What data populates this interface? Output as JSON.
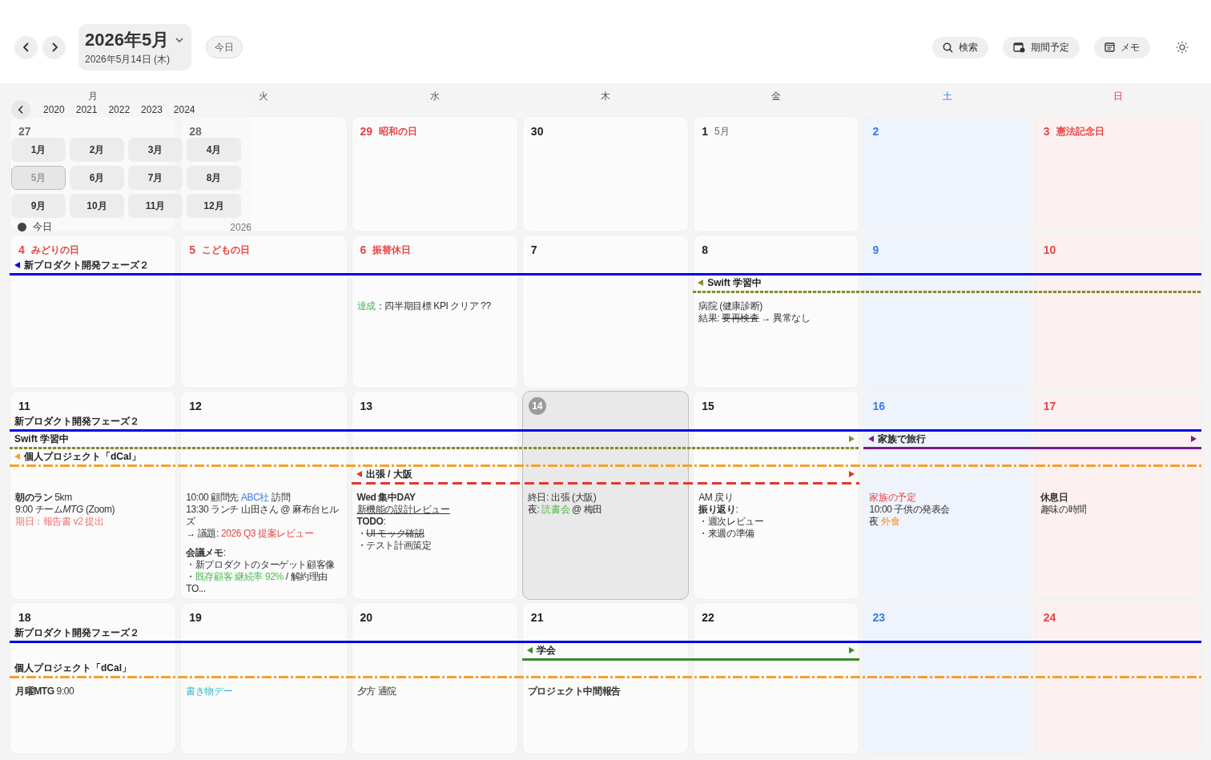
{
  "header": {
    "title": "2026年5月",
    "subtitle": "2026年5月14日 (木)",
    "today_button": "今日",
    "actions": [
      {
        "kind": "search",
        "label": "検索"
      },
      {
        "kind": "period",
        "label": "期間予定"
      },
      {
        "kind": "memo",
        "label": "メモ"
      }
    ]
  },
  "weekdays": [
    {
      "label": "月",
      "kind": "weekday"
    },
    {
      "label": "火",
      "kind": "weekday"
    },
    {
      "label": "水",
      "kind": "weekday"
    },
    {
      "label": "木",
      "kind": "weekday"
    },
    {
      "label": "金",
      "kind": "weekday"
    },
    {
      "label": "土",
      "kind": "sat"
    },
    {
      "label": "日",
      "kind": "sun"
    }
  ],
  "month_picker": {
    "years": [
      "2020",
      "2021",
      "2022",
      "2023",
      "2024"
    ],
    "months": [
      {
        "label": "1月",
        "selected": false
      },
      {
        "label": "2月",
        "selected": false
      },
      {
        "label": "3月",
        "selected": false
      },
      {
        "label": "4月",
        "selected": false
      },
      {
        "label": "5月",
        "selected": true
      },
      {
        "label": "6月",
        "selected": false
      },
      {
        "label": "7月",
        "selected": false
      },
      {
        "label": "8月",
        "selected": false
      },
      {
        "label": "9月",
        "selected": false
      },
      {
        "label": "10月",
        "selected": false
      },
      {
        "label": "11月",
        "selected": false
      },
      {
        "label": "12月",
        "selected": false
      }
    ],
    "today_label": "今日",
    "year_label": "2026"
  },
  "weeks": [
    {
      "days": [
        {
          "date": "27",
          "kind": "weekday",
          "today": false
        },
        {
          "date": "28",
          "kind": "weekday",
          "today": false
        },
        {
          "date": "29",
          "kind": "holiday",
          "holiday": "昭和の日",
          "today": false
        },
        {
          "date": "30",
          "kind": "weekday",
          "today": false
        },
        {
          "date": "1",
          "kind": "weekday",
          "month_label": "5月",
          "today": false
        },
        {
          "date": "2",
          "kind": "sat",
          "today": false
        },
        {
          "date": "3",
          "kind": "sun",
          "holiday": "憲法記念日",
          "today": false
        }
      ]
    },
    {
      "days": [
        {
          "date": "4",
          "kind": "holiday",
          "holiday": "みどりの日",
          "today": false
        },
        {
          "date": "5",
          "kind": "holiday",
          "holiday": "こどもの日",
          "today": false
        },
        {
          "date": "6",
          "kind": "holiday",
          "holiday": "振替休日",
          "today": false,
          "notes": [
            [
              {
                "text": "達成",
                "kind": "green"
              },
              "：四半期目標 KPI クリア ??"
            ]
          ]
        },
        {
          "date": "7",
          "kind": "weekday",
          "today": false
        },
        {
          "date": "8",
          "kind": "weekday",
          "today": false,
          "notes": [
            [
              "病院 (健康診断)"
            ],
            [
              "結果: ",
              {
                "text": "要再検査",
                "kind": "strike"
              },
              " → 異常なし"
            ]
          ]
        },
        {
          "date": "9",
          "kind": "sat",
          "today": false
        },
        {
          "date": "10",
          "kind": "sun",
          "today": false
        }
      ],
      "lanes": [
        [
          {
            "kind": "solid",
            "label": "新プロダクト開発フェーズ２",
            "color": "#0000ee",
            "arrow_left": true,
            "arrow_right": false
          },
          {
            "kind": "continued"
          },
          {
            "kind": "continued"
          },
          {
            "kind": "continued"
          },
          {
            "kind": "continued"
          },
          {
            "kind": "continued"
          },
          {
            "kind": "continued"
          }
        ],
        [
          {
            "kind": "gap"
          },
          {
            "kind": "gap"
          },
          {
            "kind": "gap"
          },
          {
            "kind": "gap"
          },
          {
            "kind": "dotted",
            "label": "Swift 学習中",
            "color": "#8a8a2e",
            "arrow_left": true,
            "arrow_right": false
          },
          {
            "kind": "continued"
          },
          {
            "kind": "continued"
          }
        ]
      ]
    },
    {
      "days": [
        {
          "date": "11",
          "kind": "weekday",
          "today": false,
          "notes": [
            [
              {
                "text": "朝のラン",
                "kind": "bold"
              },
              " 5km"
            ],
            [
              "9:00 チーム",
              {
                "text": "MTG",
                "kind": "italic"
              },
              " (Zoom)"
            ],
            [
              {
                "text": "期日：報告書 v2 提出",
                "kind": "pink"
              }
            ]
          ]
        },
        {
          "date": "12",
          "kind": "weekday",
          "today": false,
          "notes": [
            [
              "10:00 顧問先 ",
              {
                "text": "ABC社",
                "kind": "blue"
              },
              " 訪問"
            ],
            [
              "13:30 ランチ 山田さん @ 麻布台ヒルズ"
            ],
            [
              "→ 議題: ",
              {
                "text": "2026 Q3 提案レビュー",
                "kind": "red"
              }
            ],
            {
              "parts": [
                {
                  "text": "会議メモ",
                  "kind": "bold"
                },
                ":"
              ],
              "space_before": true
            },
            [
              "・新プロダクトのターゲット顧客像"
            ],
            [
              "・",
              {
                "text": "既存顧客 継続率 92%",
                "kind": "green"
              },
              " / 解約理由 TO..."
            ]
          ]
        },
        {
          "date": "13",
          "kind": "weekday",
          "today": false,
          "notes": [
            [
              {
                "text": "Wed 集中DAY",
                "kind": "bold"
              }
            ],
            [
              {
                "text": "新機能の設計レビュー",
                "kind": "underline"
              }
            ],
            [
              {
                "text": "TODO",
                "kind": "bold"
              },
              ":"
            ],
            [
              "・",
              {
                "text": "UI モック確認",
                "kind": "strike"
              }
            ],
            [
              "・テスト計画策定"
            ]
          ]
        },
        {
          "date": "14",
          "kind": "weekday",
          "today": true,
          "notes": [
            [
              "終日: 出張 (大阪)"
            ],
            [
              "夜: ",
              {
                "text": "読書会",
                "kind": "green"
              },
              " @ 梅田"
            ]
          ]
        },
        {
          "date": "15",
          "kind": "weekday",
          "today": false,
          "notes": [
            [
              "AM 戻り"
            ],
            [
              {
                "text": "振り返り",
                "kind": "bold"
              },
              ":"
            ],
            [
              "・週次レビュー"
            ],
            [
              "・来週の準備"
            ]
          ]
        },
        {
          "date": "16",
          "kind": "sat",
          "today": false,
          "notes": [
            [
              {
                "text": "家族の予定",
                "kind": "red"
              }
            ],
            [
              "10:00 子供の発表会"
            ],
            [
              "夜 ",
              {
                "text": "外食",
                "kind": "orange"
              }
            ]
          ]
        },
        {
          "date": "17",
          "kind": "sun",
          "today": false,
          "notes": [
            [
              {
                "text": "休息日",
                "kind": "bold"
              }
            ],
            [
              "趣味の時間"
            ]
          ]
        }
      ],
      "lanes": [
        [
          {
            "kind": "solid",
            "label": "新プロダクト開発フェーズ２",
            "color": "#0000ee",
            "arrow_left": false,
            "arrow_right": false
          },
          {
            "kind": "continued"
          },
          {
            "kind": "continued"
          },
          {
            "kind": "continued"
          },
          {
            "kind": "continued"
          },
          {
            "kind": "continued"
          },
          {
            "kind": "continued"
          }
        ],
        [
          {
            "kind": "dotted",
            "label": "Swift 学習中",
            "color": "#8a8a2e",
            "arrow_left": false,
            "arrow_right": true
          },
          {
            "kind": "continued"
          },
          {
            "kind": "continued"
          },
          {
            "kind": "continued"
          },
          {
            "kind": "continued"
          },
          {
            "kind": "solid",
            "label": "家族で旅行",
            "color": "#7b1a8c",
            "arrow_left": true,
            "arrow_right": true
          },
          {
            "kind": "continued"
          }
        ],
        [
          {
            "kind": "dashdot",
            "label": "個人プロジェクト「dCal」",
            "color": "#f5a02a",
            "arrow_left": true,
            "arrow_right": false
          },
          {
            "kind": "continued"
          },
          {
            "kind": "continued"
          },
          {
            "kind": "continued"
          },
          {
            "kind": "continued"
          },
          {
            "kind": "continued"
          },
          {
            "kind": "continued"
          }
        ],
        [
          {
            "kind": "gap"
          },
          {
            "kind": "gap"
          },
          {
            "kind": "dashed",
            "label": "出張 / 大阪",
            "color": "#e8342c",
            "arrow_left": true,
            "arrow_right": true
          },
          {
            "kind": "continued"
          },
          {
            "kind": "continued"
          }
        ]
      ]
    },
    {
      "days": [
        {
          "date": "18",
          "kind": "weekday",
          "today": false,
          "notes": [
            [
              {
                "text": "月曜MTG",
                "kind": "bold"
              },
              " 9:00"
            ]
          ]
        },
        {
          "date": "19",
          "kind": "weekday",
          "today": false,
          "notes": [
            [
              {
                "text": "書き物デー",
                "kind": "cyan"
              }
            ]
          ]
        },
        {
          "date": "20",
          "kind": "weekday",
          "today": false,
          "notes": [
            [
              "夕方 通院"
            ]
          ]
        },
        {
          "date": "21",
          "kind": "weekday",
          "today": false,
          "notes": [
            [
              {
                "text": "プロジェクト中間報告",
                "kind": "bold"
              }
            ]
          ]
        },
        {
          "date": "22",
          "kind": "weekday",
          "today": false
        },
        {
          "date": "23",
          "kind": "sat",
          "today": false
        },
        {
          "date": "24",
          "kind": "sun",
          "today": false
        }
      ],
      "lanes": [
        [
          {
            "kind": "solid",
            "label": "新プロダクト開発フェーズ２",
            "color": "#0000ee",
            "arrow_left": false,
            "arrow_right": false
          },
          {
            "kind": "continued"
          },
          {
            "kind": "continued"
          },
          {
            "kind": "continued"
          },
          {
            "kind": "continued"
          },
          {
            "kind": "continued"
          },
          {
            "kind": "continued"
          }
        ],
        [
          {
            "kind": "gap"
          },
          {
            "kind": "gap"
          },
          {
            "kind": "gap"
          },
          {
            "kind": "solid",
            "label": "学会",
            "color": "#3a8a26",
            "arrow_left": true,
            "arrow_right": true
          },
          {
            "kind": "continued"
          }
        ],
        [
          {
            "kind": "dashdot",
            "label": "個人プロジェクト「dCal」",
            "color": "#f5a02a",
            "arrow_left": false,
            "arrow_right": false
          },
          {
            "kind": "continued"
          },
          {
            "kind": "continued"
          },
          {
            "kind": "continued"
          },
          {
            "kind": "continued"
          },
          {
            "kind": "continued"
          },
          {
            "kind": "continued"
          }
        ]
      ]
    }
  ]
}
